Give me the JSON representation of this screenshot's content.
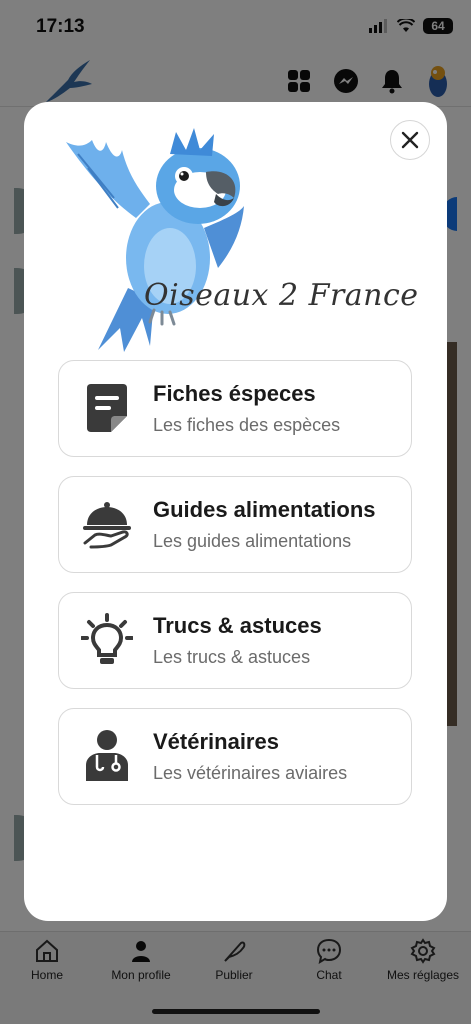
{
  "status_bar": {
    "time": "17:13",
    "battery": "64"
  },
  "app_bar": {
    "logo_icon": "bird-logo-icon",
    "actions": [
      "apps-grid-icon",
      "messenger-icon",
      "bell-icon",
      "profile-avatar"
    ]
  },
  "bottom_nav": {
    "items": [
      {
        "label": "Home",
        "icon": "home-icon"
      },
      {
        "label": "Mon profile",
        "icon": "person-icon"
      },
      {
        "label": "Publier",
        "icon": "feather-icon"
      },
      {
        "label": "Chat",
        "icon": "chat-icon"
      },
      {
        "label": "Mes réglages",
        "icon": "gear-icon"
      }
    ]
  },
  "modal": {
    "brand_name": "Oiseaux 2 France",
    "close_icon": "close-icon",
    "items": [
      {
        "title": "Fiches éspeces",
        "subtitle": "Les fiches des espèces",
        "icon": "document-icon"
      },
      {
        "title": "Guides alimentations",
        "subtitle": "Les guides alimentations",
        "icon": "food-tray-icon"
      },
      {
        "title": "Trucs & astuces",
        "subtitle": "Les trucs & astuces",
        "icon": "lightbulb-icon"
      },
      {
        "title": "Vétérinaires",
        "subtitle": "Les vétérinaires aviaires",
        "icon": "doctor-icon"
      }
    ]
  },
  "colors": {
    "accent": "#1877f2",
    "parrot_blue": "#5aa6e6",
    "overlay": "rgba(0,0,0,0.5)"
  }
}
